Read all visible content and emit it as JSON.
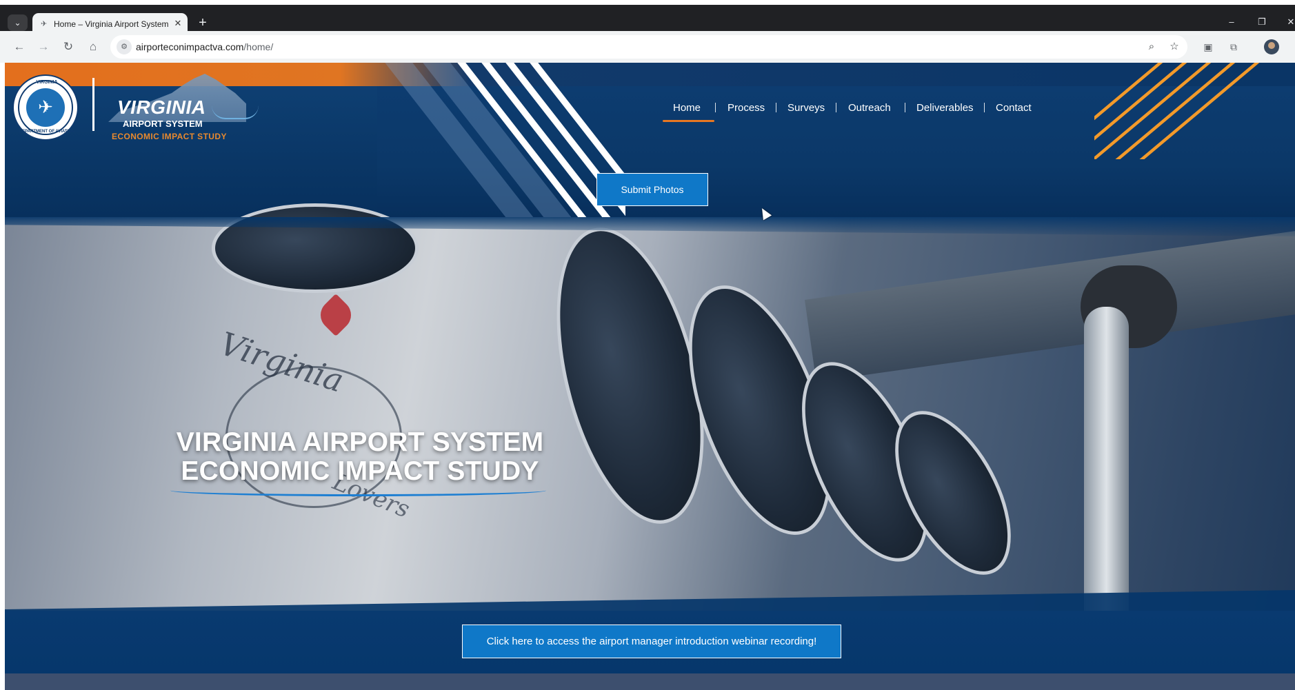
{
  "browser": {
    "tab_title": "Home – Virginia Airport System",
    "tab_close": "✕",
    "new_tab": "+",
    "url_domain": "airporteconimpactva.com",
    "url_path": "/home/",
    "controls": {
      "back": "←",
      "forward": "→",
      "reload": "↻",
      "home": "⌂",
      "tab_list": "⌄",
      "zoom": "⌕",
      "bookmark": "☆",
      "extensions": "⧉",
      "minimize": "–",
      "restore": "❐",
      "close": "✕"
    }
  },
  "site": {
    "logo": {
      "seal_top": "VIRGINIA",
      "seal_bottom": "DEPARTMENT OF AVIATION",
      "brand": "VIRGINIA",
      "brand_sub": "AIRPORT SYSTEM",
      "brand_tagline": "ECONOMIC IMPACT STUDY"
    },
    "nav": {
      "items": [
        "Home",
        "Process",
        "Surveys",
        "Outreach",
        "Deliverables",
        "Contact"
      ],
      "active": "Home"
    },
    "submit_button": "Submit Photos",
    "hero": {
      "title_line1": "VIRGINIA AIRPORT SYSTEM",
      "title_line2": "ECONOMIC IMPACT STUDY",
      "plane_text_top": "Virginia",
      "plane_text_bottom": "Lovers"
    },
    "webinar_button": "Click here to access the airport manager introduction webinar recording!"
  },
  "colors": {
    "navy": "#05366a",
    "orange": "#e36f1d",
    "button_blue": "#0f78c8"
  }
}
